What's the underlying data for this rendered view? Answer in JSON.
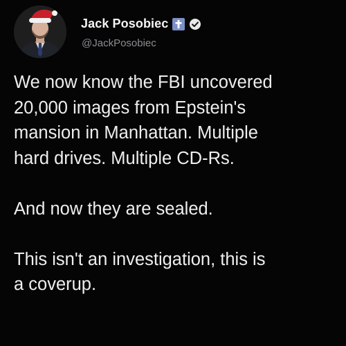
{
  "author": {
    "display_name": "Jack Posobiec",
    "handle": "@JackPosobiec",
    "avatar_icon": "profile-photo-santa-hat",
    "badges": [
      "cross-icon",
      "verified-icon"
    ]
  },
  "tweet": {
    "paragraphs": [
      "We now know the FBI uncovered\n20,000 images from Epstein's\nmansion in Manhattan. Multiple\nhard drives. Multiple CD-Rs.",
      "And now they are sealed.",
      "This isn't an investigation, this is\na coverup."
    ]
  },
  "colors": {
    "background": "#050505",
    "text": "#eeeeee",
    "handle": "#8a8d91",
    "cross_badge": "#7d8fc7"
  }
}
